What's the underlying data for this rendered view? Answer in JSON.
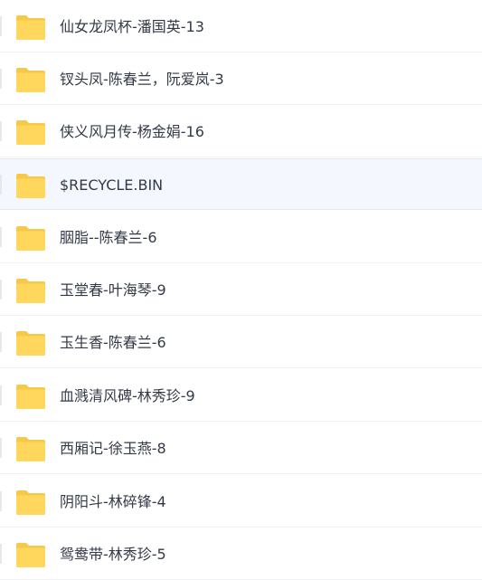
{
  "colors": {
    "folder_back": "#f7c948",
    "folder_front": "#ffd75c",
    "selected_row": "#f4f8fe",
    "text": "#333a47"
  },
  "files": [
    {
      "name": "仙女龙凤杯-潘国英-13",
      "icon": "folder-icon",
      "selected": false
    },
    {
      "name": "钗头凤-陈春兰，阮爱岚-3",
      "icon": "folder-icon",
      "selected": false
    },
    {
      "name": "侠义风月传-杨金娟-16",
      "icon": "folder-icon",
      "selected": false
    },
    {
      "name": "$RECYCLE.BIN",
      "icon": "folder-icon",
      "selected": true
    },
    {
      "name": "胭脂--陈春兰-6",
      "icon": "folder-icon",
      "selected": false
    },
    {
      "name": "玉堂春-叶海琴-9",
      "icon": "folder-icon",
      "selected": false
    },
    {
      "name": "玉生香-陈春兰-6",
      "icon": "folder-icon",
      "selected": false
    },
    {
      "name": "血溅清风碑-林秀珍-9",
      "icon": "folder-icon",
      "selected": false
    },
    {
      "name": "西厢记-徐玉燕-8",
      "icon": "folder-icon",
      "selected": false
    },
    {
      "name": "阴阳斗-林碎锋-4",
      "icon": "folder-icon",
      "selected": false
    },
    {
      "name": "鸳鸯带-林秀珍-5",
      "icon": "folder-icon",
      "selected": false
    }
  ]
}
